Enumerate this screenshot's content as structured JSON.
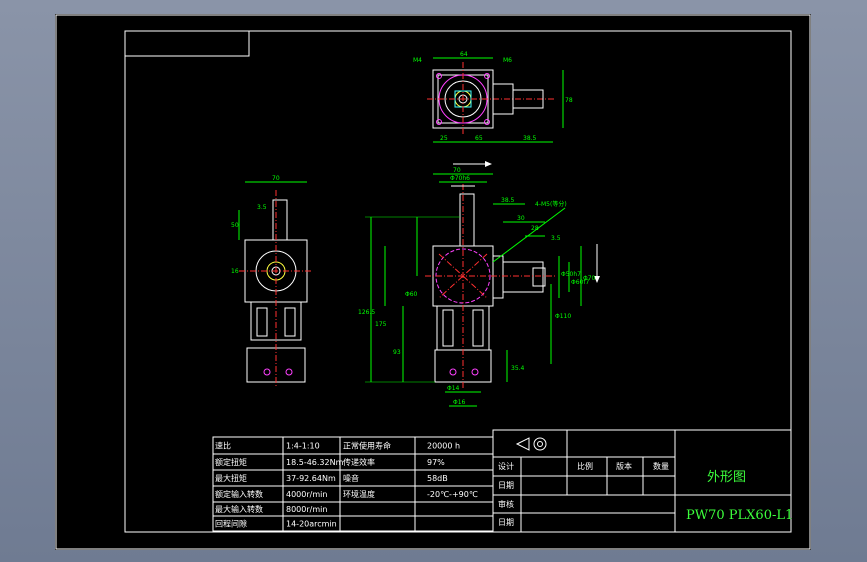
{
  "colors": {
    "outline": "#ffffff",
    "dimension": "#00ff00",
    "centerline": "#ff3030",
    "magenta": "#ff40ff",
    "yellow": "#ffff40",
    "cyan": "#40ffff"
  },
  "spec_table": [
    {
      "label1": "速比",
      "value1": "1:4-1:10",
      "label2": "正常使用寿命",
      "value2": "20000 h"
    },
    {
      "label1": "额定扭矩",
      "value1": "18.5-46.32Nm",
      "label2": "传递效率",
      "value2": "97%"
    },
    {
      "label1": "最大扭矩",
      "value1": "37-92.64Nm",
      "label2": "噪音",
      "value2": "58dB"
    },
    {
      "label1": "额定输入转数",
      "value1": "4000r/min",
      "label2": "环境温度",
      "value2": "-20℃-+90℃"
    },
    {
      "label1": "最大输入转数",
      "value1": "8000r/min",
      "label2": "",
      "value2": ""
    },
    {
      "label1": "回程间隙",
      "value1": "14-20arcmin",
      "label2": "",
      "value2": ""
    }
  ],
  "title_block": {
    "row_labels": [
      "设计",
      "日期",
      "审核",
      "日期"
    ],
    "col_labels": [
      "比例",
      "版本",
      "数量"
    ],
    "drawing_name": "外形图",
    "part_number": "PW70 PLX60-L1"
  },
  "dims": {
    "top_view": [
      "64",
      "25",
      "65",
      "38.5",
      "78",
      "M4",
      "M6"
    ],
    "side_view": [
      "70",
      "3.5",
      "50",
      "16"
    ],
    "front_view": [
      "70",
      "Φ70h6",
      "38.5",
      "4-M5(等分)",
      "30",
      "28",
      "3.5",
      "Φ60",
      "126.5",
      "175",
      "93",
      "Φ70",
      "Φ110",
      "Φ50h7",
      "Φ14",
      "Φ16",
      "Φ60f7",
      "35.4"
    ]
  }
}
